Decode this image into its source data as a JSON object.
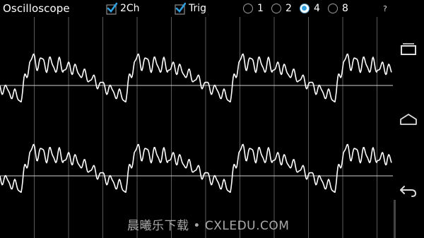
{
  "app": {
    "title": "Oscilloscope"
  },
  "controls": {
    "two_channel": {
      "label": "2Ch",
      "checked": true
    },
    "trigger": {
      "label": "Trig",
      "checked": true
    },
    "timebase_options": [
      "1",
      "2",
      "4",
      "8"
    ],
    "timebase_selected": "4",
    "help_label": "?"
  },
  "accent_color": "#2f9fe0",
  "icons": {
    "recent": "recent-apps-icon",
    "home": "home-icon",
    "back": "back-icon"
  },
  "watermark": {
    "text": "晨曦乐下载 • CXLEDU.COM"
  }
}
